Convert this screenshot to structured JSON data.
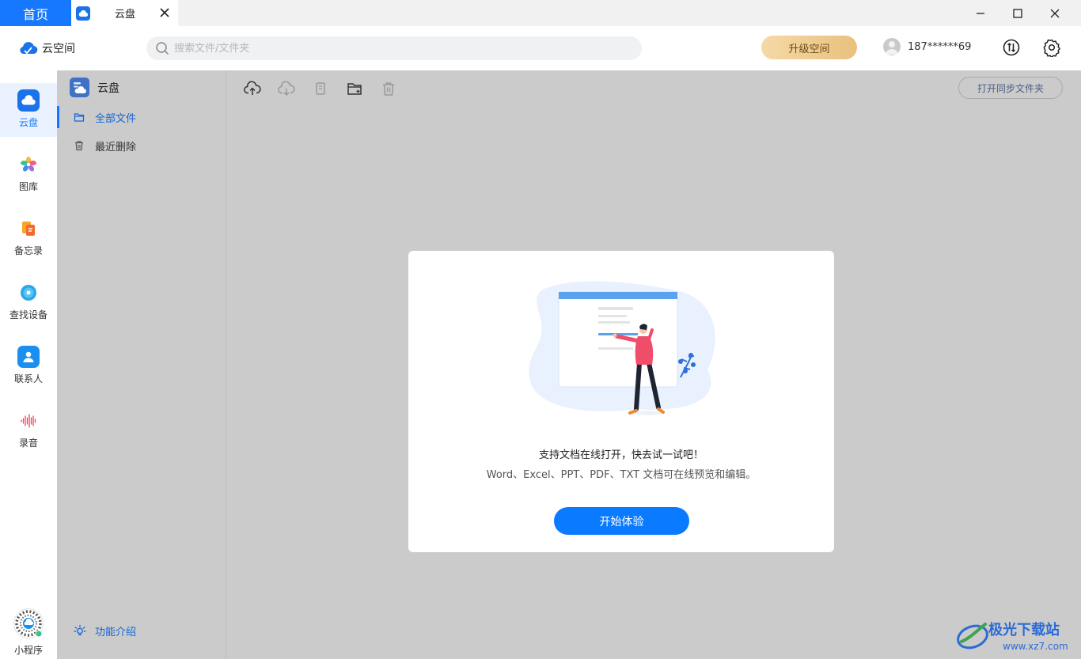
{
  "tabs": {
    "home_label": "首页",
    "cloud_label": "云盘"
  },
  "header": {
    "brand": "云空间",
    "search_placeholder": "搜索文件/文件夹",
    "upgrade_label": "升级空间",
    "account": "187******69"
  },
  "nav": {
    "items": [
      {
        "label": "云盘",
        "icon": "cloud-drive-icon"
      },
      {
        "label": "图库",
        "icon": "gallery-icon"
      },
      {
        "label": "备忘录",
        "icon": "notes-icon"
      },
      {
        "label": "查找设备",
        "icon": "find-device-icon"
      },
      {
        "label": "联系人",
        "icon": "contacts-icon"
      },
      {
        "label": "录音",
        "icon": "recorder-icon"
      }
    ],
    "mini_program": "小程序"
  },
  "panel": {
    "title": "云盘",
    "items": [
      {
        "label": "全部文件",
        "icon": "folder-icon"
      },
      {
        "label": "最近删除",
        "icon": "trash-icon"
      }
    ],
    "feature_intro": "功能介绍"
  },
  "toolbar": {
    "sync_folder_label": "打开同步文件夹",
    "icons": [
      "upload-icon",
      "download-icon",
      "copy-icon",
      "new-folder-icon",
      "delete-icon"
    ]
  },
  "modal": {
    "title": "支持文档在线打开，快去试一试吧！",
    "description": "Word、Excel、PPT、PDF、TXT 文档可在线预览和编辑。",
    "button_label": "开始体验"
  },
  "watermark": {
    "text": "极光下载站",
    "url_text": "www.xz7.com"
  },
  "colors": {
    "accent": "#1677ff",
    "upgrade_gold": "#e9c17e",
    "overlay": "#cbcbcb"
  }
}
